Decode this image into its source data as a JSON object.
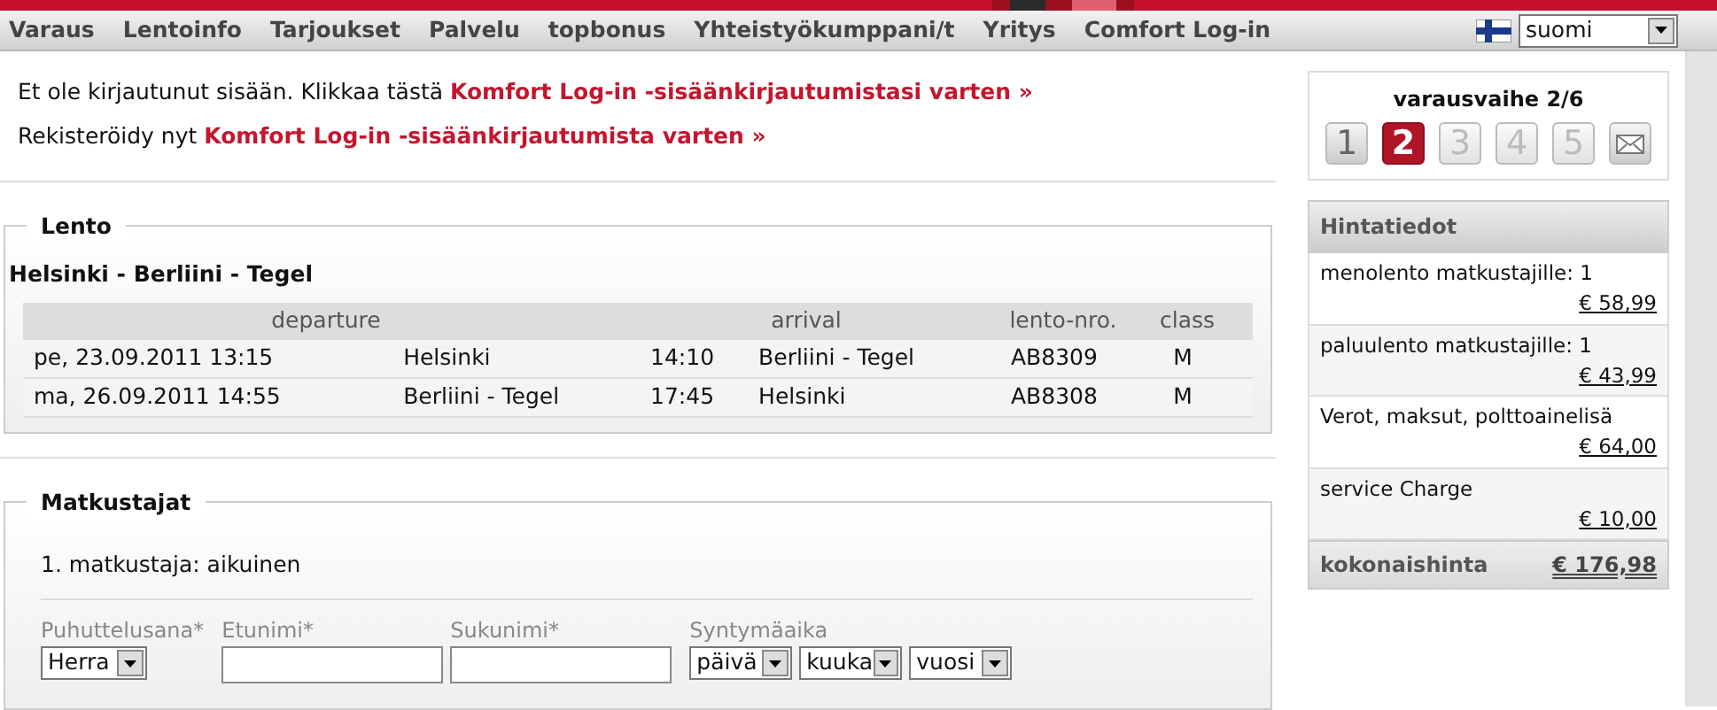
{
  "nav": {
    "items": [
      "Varaus",
      "Lentoinfo",
      "Tarjoukset",
      "Palvelu",
      "topbonus",
      "Yhteistyökumppani/t",
      "Yritys",
      "Comfort Log-in"
    ],
    "language": "suomi"
  },
  "login": [
    {
      "text": "Et ole kirjautunut sisään. Klikkaa tästä",
      "link": "Komfort Log-in -sisäänkirjautumistasi varten »"
    },
    {
      "text": "Rekisteröidy nyt",
      "link": "Komfort Log-in -sisäänkirjautumista varten »"
    }
  ],
  "flight": {
    "legend": "Lento",
    "route": "Helsinki - Berliini - Tegel",
    "header": [
      "departure",
      "arrival",
      "lento-nro.",
      "class"
    ],
    "rows": [
      [
        "pe, 23.09.2011 13:15",
        "Helsinki",
        "14:10",
        "Berliini - Tegel",
        "AB8309",
        "M"
      ],
      [
        "ma, 26.09.2011 14:55",
        "Berliini - Tegel",
        "17:45",
        "Helsinki",
        "AB8308",
        "M"
      ]
    ]
  },
  "passengers": {
    "legend": "Matkustajat",
    "title": "1. matkustaja: aikuinen",
    "fields": [
      {
        "kind": "select",
        "label": "Puhuttelusana*",
        "value": "Herra"
      },
      {
        "kind": "input",
        "label": "Etunimi*"
      },
      {
        "kind": "input",
        "label": "Sukunimi*"
      },
      {
        "kind": "select",
        "label": "Syntymäaika",
        "value": "päivä"
      },
      {
        "kind": "select",
        "value": "kuuka"
      },
      {
        "kind": "select",
        "value": "vuosi"
      }
    ]
  },
  "steps": {
    "title": "varausvaihe 2/6",
    "items": [
      {
        "kind": "number",
        "label": "1",
        "selected": false,
        "disabled": false
      },
      {
        "kind": "number",
        "label": "2",
        "selected": true,
        "disabled": false
      },
      {
        "kind": "number",
        "label": "3",
        "selected": false,
        "disabled": true
      },
      {
        "kind": "number",
        "label": "4",
        "selected": false,
        "disabled": true
      },
      {
        "kind": "number",
        "label": "5",
        "selected": false,
        "disabled": true
      },
      {
        "kind": "envelope",
        "selected": false,
        "disabled": false
      }
    ]
  },
  "prices": {
    "title": "Hintatiedot",
    "rows": [
      {
        "label": "menolento matkustajille: 1",
        "amount": "€ 58,99"
      },
      {
        "label": "paluulento matkustajille: 1",
        "amount": "€ 43,99"
      },
      {
        "label": "Verot, maksut, polttoainelisä",
        "amount": "€ 64,00"
      },
      {
        "label": "service Charge",
        "amount": "€ 10,00"
      }
    ],
    "total_label": "kokonaishinta",
    "total": "€ 176,98"
  }
}
